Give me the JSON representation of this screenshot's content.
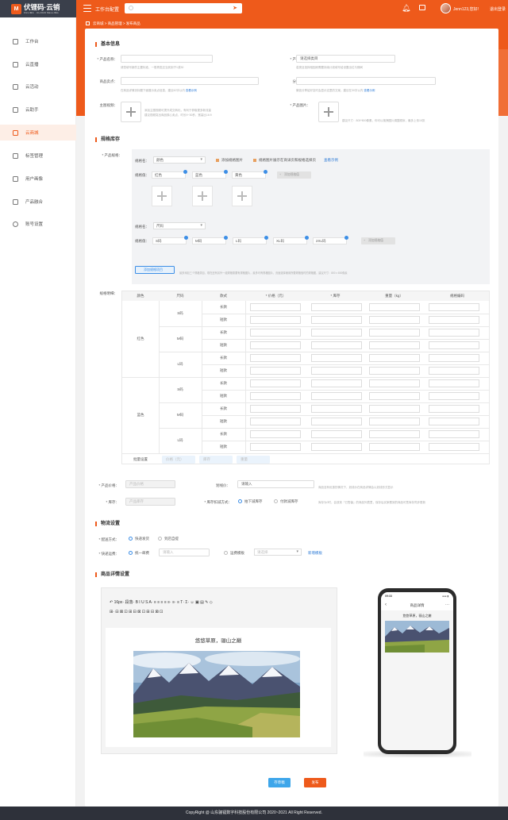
{
  "app": {
    "logo_glyph": "M",
    "logo_name": "伏锂码·云销",
    "logo_sub": "FULIMA . CLOUD SELLING",
    "top_title": "工作台配置",
    "user": "Jenn123,您好!",
    "logout": "退出登录"
  },
  "sidebar": {
    "items": [
      {
        "label": "工作台",
        "icon": "desk-icon"
      },
      {
        "label": "云直播",
        "icon": "live-icon"
      },
      {
        "label": "云活动",
        "icon": "activity-icon"
      },
      {
        "label": "云助手",
        "icon": "assistant-icon"
      },
      {
        "label": "云商城",
        "icon": "mall-icon",
        "active": true
      },
      {
        "label": "标签管理",
        "icon": "folder-icon"
      },
      {
        "label": "用户画像",
        "icon": "user-icon"
      },
      {
        "label": "产品融合",
        "icon": "product-icon"
      },
      {
        "label": "账号设置",
        "icon": "gear-icon"
      }
    ]
  },
  "breadcrumb": "云商城 > 商品管理 > 发布商品",
  "basic": {
    "title": "基本信息",
    "name_label": "* 产品名称：",
    "name_hint": "请您填写新的主要标准、一般再发应当到到子1或30",
    "category_label": "* 产品类目：",
    "category_value": "请选择类目",
    "category_hint": "若类目选择相因而需要持续计划填写给设置出位与期间",
    "sell_label": "商品卖点：",
    "sell_hint": "在商品详情页标题下面展示卖点信息，建议60字以内",
    "sell_link": "查看示例",
    "share_label": "分享描述：",
    "share_hint": "微信分享给好友时会显示这里的文案，建议在30字以内",
    "share_link": "查看示例",
    "main_img_label": "主图视频：",
    "main_img_hint1": "添加主图视频可提升成交转化，有利于获取更多新流量",
    "main_img_hint2": "建议视频突出商品核心卖点，时长9~30秒，宽高比16:9",
    "product_img_label": "* 产品图片：",
    "product_img_hint": "建议尺寸：800*800像素，你可以拖拽图片调整顺序，最多上传15张"
  },
  "spec": {
    "title": "规格库存",
    "spec_label": "* 产品规格：",
    "group1": {
      "name_label": "规格名：",
      "name_value": "颜色",
      "check1": "添加规格图片",
      "check2": "规格图片展示在商详页和规格选择页",
      "check_link": "查看示例",
      "value_label": "规格值：",
      "values": [
        "红色",
        "蓝色",
        "黄色"
      ],
      "add_btn": "添加规格值"
    },
    "group2": {
      "name_label": "规格名：",
      "name_value": "尺码",
      "value_label": "规格值：",
      "values": [
        "S码",
        "M码",
        "L码",
        "XL码",
        "2XL码"
      ],
      "add_btn": "添加规格值"
    },
    "add_group_btn": "添加规格项目",
    "add_group_hint": "最多添加三个规格类目，现在还有另外一组规格需要有规格图片，最多可有规格图片，页面选择使用所要规格值时的规格图，建议尺寸：800 x 800像素"
  },
  "table": {
    "label": "规格明细：",
    "headers": [
      "颜色",
      "尺码",
      "款式",
      "* 价格（元）",
      "* 库存",
      "重量（kg）",
      "规格编码"
    ],
    "colors": [
      "红色",
      "蓝色"
    ],
    "sizes": [
      "S码",
      "M码",
      "L码"
    ],
    "styles": [
      "长款",
      "短款"
    ],
    "batch_label": "批量设置",
    "batch_price": "价格（元）",
    "batch_stock": "库存",
    "batch_weight": "重量"
  },
  "price": {
    "price_label": "* 产品价格：",
    "price_placeholder": "产品价格",
    "strike_label": "划线价：",
    "strike_placeholder": "请输入",
    "strike_hint": "商品没有优惠的情况下，划线价在商品详情会以划线形式显示",
    "stock_label": "* 库存：",
    "stock_placeholder": "产品库存",
    "deduct_label": "* 库存扣减方式：",
    "deduct_opt1": "拍下减库存",
    "deduct_opt2": "付款减库存",
    "deduct_hint": "库存为0时，会放到『已售罄』的商品列表里，保存后买家看到的商品可售库存同步更新"
  },
  "logistics": {
    "title": "物流设置",
    "delivery_label": "* 配送方式：",
    "delivery_opt1": "快递发货",
    "delivery_opt2": "到店自提",
    "freight_label": "* 快递运费：",
    "freight_opt1": "统一邮费",
    "freight_placeholder": "请输入",
    "freight_opt2": "运费模板",
    "template_placeholder": "请选择",
    "template_link": "新增模板"
  },
  "detail": {
    "title": "商品详情设置",
    "toolbar_font": "16px",
    "toolbar_para": "段落",
    "toolbar_row1": "B I U S A· ≡ ≡ ≡ ≡ ≡· ≡· ≡ T· Σ· ☺ ▣ ▤ ✎ ◇",
    "toolbar_row2": "⊞· ⊟ ⊠ ⊡ ⊞ ⊟ ⊠ ⊡ ⊞ ⊟ ⊠ ⊡",
    "editor_title": "悠悠草原，骊山之巅",
    "phone_time": "09:33",
    "phone_signal": "●●● ▮",
    "phone_back": "‹",
    "phone_more": "···",
    "phone_title": "商品详情",
    "phone_text": "悠悠草原，骊山之巅"
  },
  "actions": {
    "save": "存草稿",
    "publish": "发布"
  },
  "footer": "CopyRight @ 山东骊镭数字科技股份有限公司 2020~2021 All Right Reserved.",
  "colors": {
    "brand": "#ee5a1b",
    "link": "#2e7bd6",
    "accent_blue": "#3c8ee6",
    "dark": "#3a3f4b"
  }
}
